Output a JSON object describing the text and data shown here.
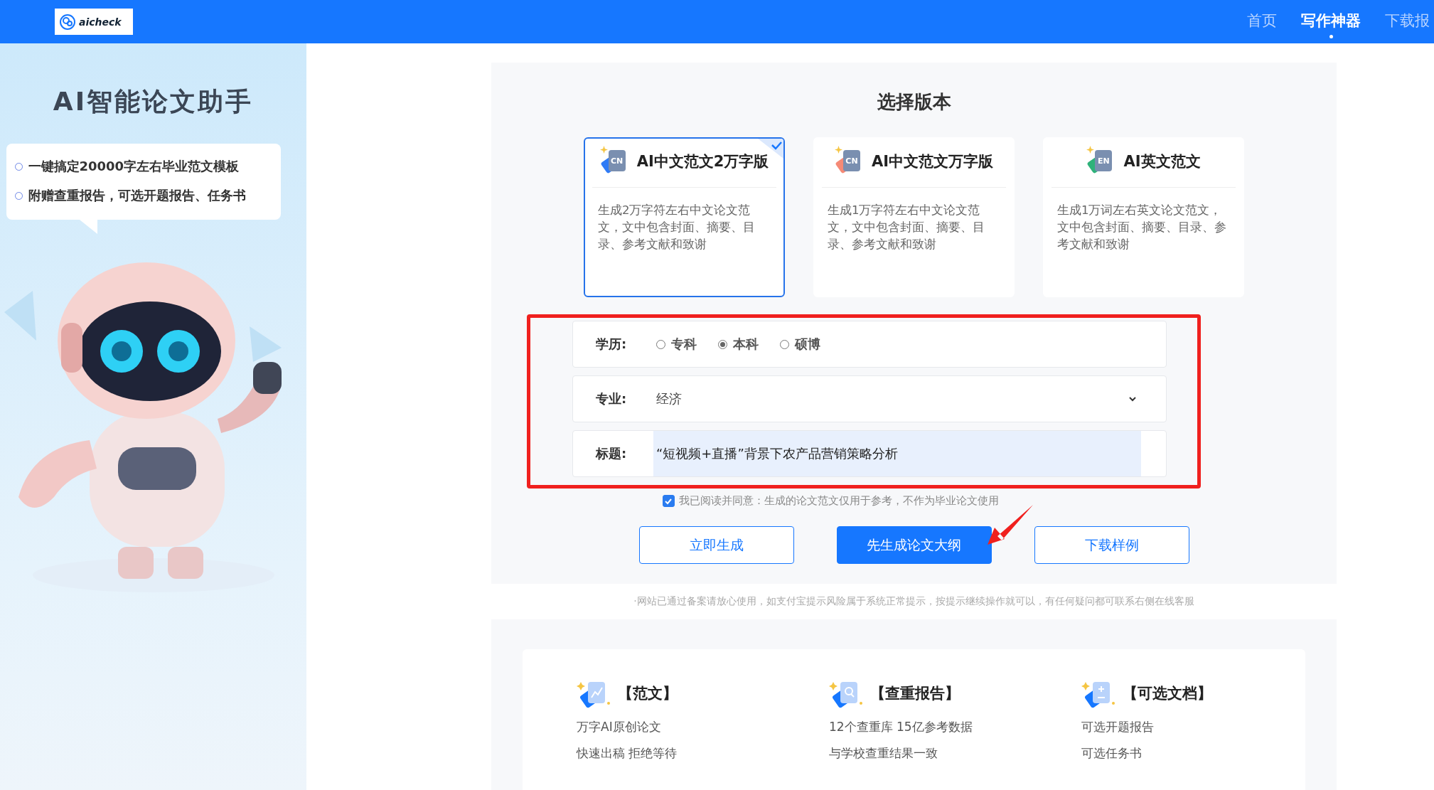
{
  "header": {
    "logo": "aicheck",
    "nav": [
      {
        "label": "首页",
        "selected": false
      },
      {
        "label": "写作神器",
        "selected": true
      },
      {
        "label": "下载报",
        "selected": false
      }
    ]
  },
  "sidebar": {
    "title": "AI智能论文助手",
    "bullets": [
      "一键搞定20000字左右毕业范文模板",
      "附赠查重报告，可选开题报告、任务书"
    ]
  },
  "version_picker": {
    "title": "选择版本",
    "cards": [
      {
        "title": "AI中文范文2万字版",
        "badge": "CN",
        "color": "#2f7bf6",
        "description": "生成2万字符左右中文论文范文，文中包含封面、摘要、目录、参考文献和致谢",
        "selected": true
      },
      {
        "title": "AI中文范文万字版",
        "badge": "CN",
        "color": "#f58a76",
        "description": "生成1万字符左右中文论文范文，文中包含封面、摘要、目录、参考文献和致谢",
        "selected": false
      },
      {
        "title": "AI英文范文",
        "badge": "EN",
        "color": "#2fb27a",
        "description": "生成1万词左右英文论文范文，文中包含封面、摘要、目录、参考文献和致谢",
        "selected": false
      }
    ]
  },
  "form": {
    "education": {
      "label": "学历:",
      "options": [
        {
          "label": "专科",
          "selected": false
        },
        {
          "label": "本科",
          "selected": true
        },
        {
          "label": "硕博",
          "selected": false
        }
      ]
    },
    "major": {
      "label": "专业:",
      "value": "经济"
    },
    "title_field": {
      "label": "标题:",
      "value": "“短视频+直播”背景下农产品营销策略分析"
    }
  },
  "agreement": {
    "checked": true,
    "text": "我已阅读并同意：生成的论文范文仅用于参考，不作为毕业论文使用"
  },
  "buttons": [
    {
      "label": "立即生成",
      "kind": "outline"
    },
    {
      "label": "先生成论文大纲",
      "kind": "primary"
    },
    {
      "label": "下载样例",
      "kind": "outline"
    }
  ],
  "notice": "·网站已通过备案请放心使用，如支付宝提示风险属于系统正常提示，按提示继续操作就可以，有任何疑问都可联系右侧在线客服",
  "features": [
    {
      "title": "【范文】",
      "lines": [
        "万字AI原创论文",
        "快速出稿 拒绝等待"
      ]
    },
    {
      "title": "【查重报告】",
      "lines": [
        "12个查重库 15亿参考数据",
        "与学校查重结果一致"
      ]
    },
    {
      "title": "【可选文档】",
      "lines": [
        "可选开题报告",
        "可选任务书"
      ]
    }
  ]
}
